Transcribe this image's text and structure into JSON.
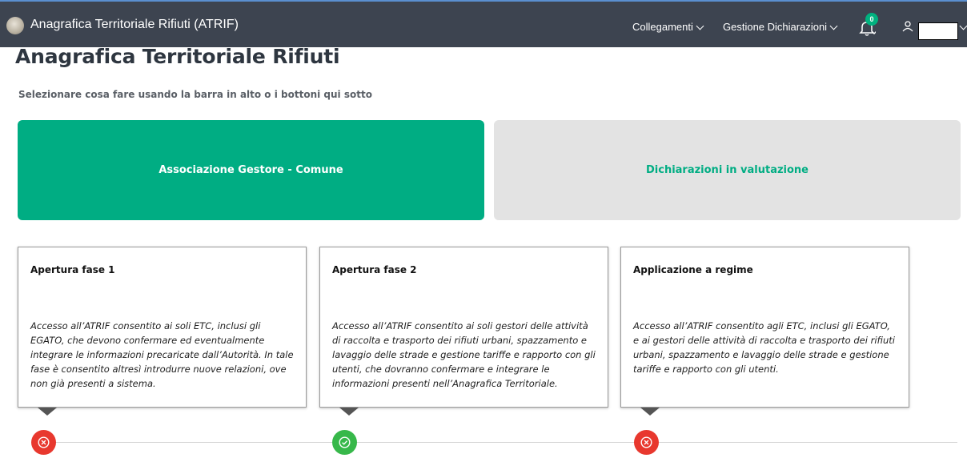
{
  "header": {
    "app_title": "Anagrafica Territoriale Rifiuti (ATRIF)",
    "nav": [
      {
        "label": "Collegamenti"
      },
      {
        "label": "Gestione Dichiarazioni"
      }
    ],
    "notifications_count": "0"
  },
  "page": {
    "title": "Anagrafica Territoriale Rifiuti",
    "subtitle": "Selezionare cosa fare usando la barra in alto o i bottoni qui sotto"
  },
  "actions": {
    "primary_label": "Associazione Gestore - Comune",
    "secondary_label": "Dichiarazioni in valutazione"
  },
  "phases": [
    {
      "title": "Apertura fase 1",
      "text": "Accesso all’ATRIF consentito ai soli ETC, inclusi gli EGATO, che devono confermare ed eventualmente integrare le informazioni precaricate dall’Autorità. In tale fase è consentito altresì introdurre nuove relazioni, ove non già presenti a sistema.",
      "status": "inactive"
    },
    {
      "title": "Apertura fase 2",
      "text": "Accesso all’ATRIF consentito ai soli gestori delle attività di raccolta e trasporto dei rifiuti urbani, spazzamento e lavaggio delle strade e gestione tariffe e rapporto con gli utenti, che dovranno confermare e integrare le informazioni presenti nell’Anagrafica Territoriale.",
      "status": "active"
    },
    {
      "title": "Applicazione a regime",
      "text": "Accesso all’ATRIF consentito agli ETC, inclusi gli EGATO, e ai gestori delle attività di raccolta e trasporto dei rifiuti urbani, spazzamento e lavaggio delle strade e gestione tariffe e rapporto con gli utenti.",
      "status": "inactive"
    }
  ],
  "colors": {
    "header_bg": "#3d4450",
    "accent_green": "#00ad83",
    "status_red": "#e8382e",
    "status_green": "#37b84a"
  }
}
